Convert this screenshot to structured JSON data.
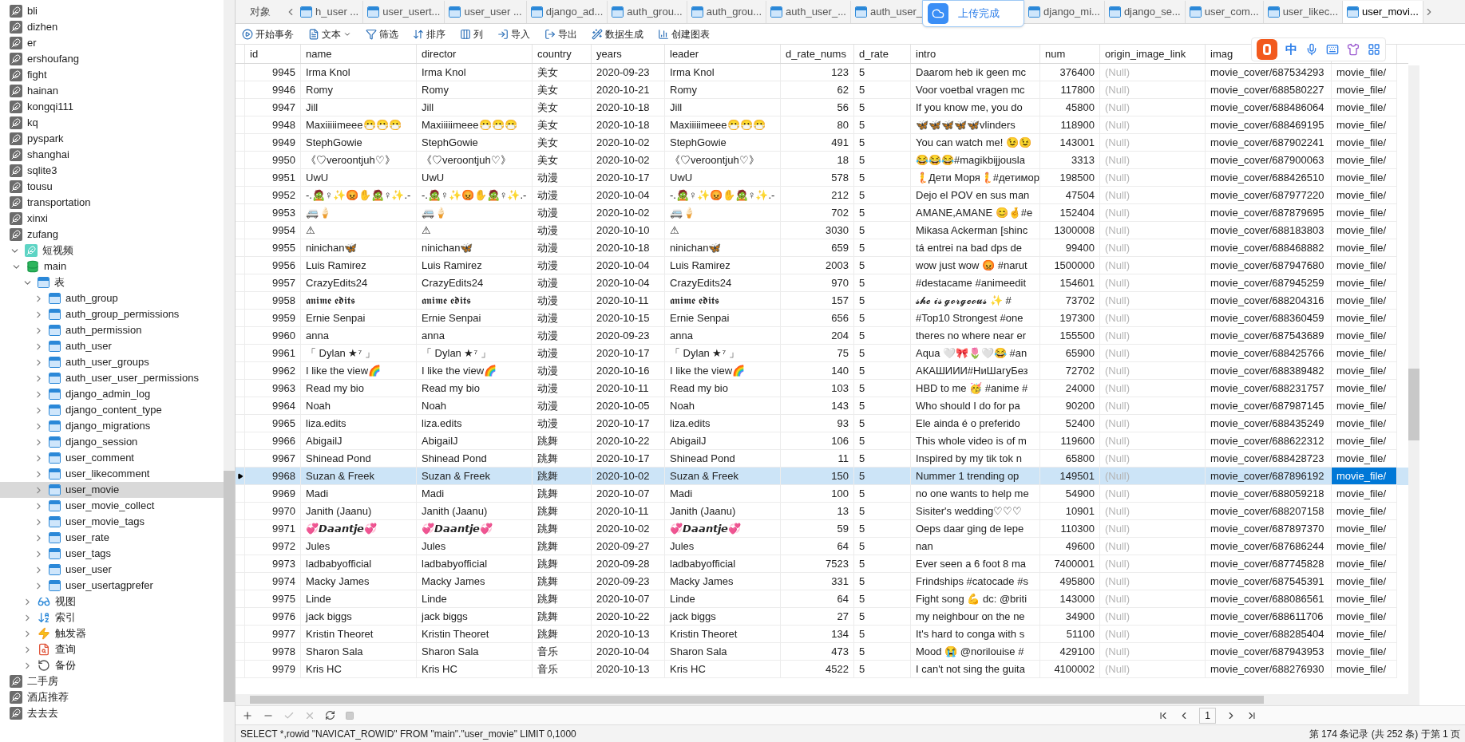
{
  "sidebar": {
    "items": [
      {
        "label": "bli",
        "kind": "connection",
        "expanded": false,
        "selected": false
      },
      {
        "label": "dizhen",
        "kind": "connection",
        "expanded": false,
        "selected": false
      },
      {
        "label": "er",
        "kind": "connection",
        "expanded": false,
        "selected": false
      },
      {
        "label": "ershoufang",
        "kind": "connection",
        "expanded": false,
        "selected": false
      },
      {
        "label": "fight",
        "kind": "connection",
        "expanded": false,
        "selected": false
      },
      {
        "label": "hainan",
        "kind": "connection",
        "expanded": false,
        "selected": false
      },
      {
        "label": "kongqi111",
        "kind": "connection",
        "expanded": false,
        "selected": false
      },
      {
        "label": "kq",
        "kind": "connection",
        "expanded": false,
        "selected": false
      },
      {
        "label": "pyspark",
        "kind": "connection",
        "expanded": false,
        "selected": false
      },
      {
        "label": "shanghai",
        "kind": "connection",
        "expanded": false,
        "selected": false
      },
      {
        "label": "sqlite3",
        "kind": "connection",
        "expanded": false,
        "selected": false
      },
      {
        "label": "tousu",
        "kind": "connection",
        "expanded": false,
        "selected": false
      },
      {
        "label": "transportation",
        "kind": "connection",
        "expanded": false,
        "selected": false
      },
      {
        "label": "xinxi",
        "kind": "connection",
        "expanded": false,
        "selected": false
      },
      {
        "label": "zufang",
        "kind": "connection",
        "expanded": false,
        "selected": false
      },
      {
        "label": "短视频",
        "kind": "active-connection",
        "expanded": true,
        "selected": false,
        "children": [
          {
            "label": "main",
            "kind": "database",
            "expanded": true,
            "selected": false,
            "children": [
              {
                "label": "表",
                "kind": "tables",
                "expanded": true,
                "selected": false,
                "children": [
                  {
                    "label": "auth_group",
                    "kind": "table",
                    "expanded": false,
                    "selected": false
                  },
                  {
                    "label": "auth_group_permissions",
                    "kind": "table",
                    "expanded": false,
                    "selected": false
                  },
                  {
                    "label": "auth_permission",
                    "kind": "table",
                    "expanded": false,
                    "selected": false
                  },
                  {
                    "label": "auth_user",
                    "kind": "table",
                    "expanded": false,
                    "selected": false
                  },
                  {
                    "label": "auth_user_groups",
                    "kind": "table",
                    "expanded": false,
                    "selected": false
                  },
                  {
                    "label": "auth_user_user_permissions",
                    "kind": "table",
                    "expanded": false,
                    "selected": false
                  },
                  {
                    "label": "django_admin_log",
                    "kind": "table",
                    "expanded": false,
                    "selected": false
                  },
                  {
                    "label": "django_content_type",
                    "kind": "table",
                    "expanded": false,
                    "selected": false
                  },
                  {
                    "label": "django_migrations",
                    "kind": "table",
                    "expanded": false,
                    "selected": false
                  },
                  {
                    "label": "django_session",
                    "kind": "table",
                    "expanded": false,
                    "selected": false
                  },
                  {
                    "label": "user_comment",
                    "kind": "table",
                    "expanded": false,
                    "selected": false
                  },
                  {
                    "label": "user_likecomment",
                    "kind": "table",
                    "expanded": false,
                    "selected": false
                  },
                  {
                    "label": "user_movie",
                    "kind": "table",
                    "expanded": false,
                    "selected": true
                  },
                  {
                    "label": "user_movie_collect",
                    "kind": "table",
                    "expanded": false,
                    "selected": false
                  },
                  {
                    "label": "user_movie_tags",
                    "kind": "table",
                    "expanded": false,
                    "selected": false
                  },
                  {
                    "label": "user_rate",
                    "kind": "table",
                    "expanded": false,
                    "selected": false
                  },
                  {
                    "label": "user_tags",
                    "kind": "table",
                    "expanded": false,
                    "selected": false
                  },
                  {
                    "label": "user_user",
                    "kind": "table",
                    "expanded": false,
                    "selected": false
                  },
                  {
                    "label": "user_usertagprefer",
                    "kind": "table",
                    "expanded": false,
                    "selected": false
                  }
                ]
              },
              {
                "label": "视图",
                "kind": "views",
                "expanded": false,
                "selected": false
              },
              {
                "label": "索引",
                "kind": "indexes",
                "expanded": false,
                "selected": false
              },
              {
                "label": "触发器",
                "kind": "triggers",
                "expanded": false,
                "selected": false
              },
              {
                "label": "查询",
                "kind": "queries",
                "expanded": false,
                "selected": false
              },
              {
                "label": "备份",
                "kind": "backups",
                "expanded": false,
                "selected": false
              }
            ]
          }
        ]
      },
      {
        "label": "二手房",
        "kind": "connection",
        "expanded": false,
        "selected": false
      },
      {
        "label": "酒店推荐",
        "kind": "connection",
        "expanded": false,
        "selected": false
      },
      {
        "label": "去去去",
        "kind": "connection",
        "expanded": false,
        "selected": false
      }
    ]
  },
  "tabs": [
    {
      "label": "对象",
      "kind": "objects",
      "selected": false
    },
    {
      "label": "h_user ...",
      "kind": "table",
      "selected": false
    },
    {
      "label": "user_usert...",
      "kind": "table",
      "selected": false
    },
    {
      "label": "user_user ...",
      "kind": "table",
      "selected": false
    },
    {
      "label": "django_ad...",
      "kind": "table",
      "selected": false
    },
    {
      "label": "auth_grou...",
      "kind": "table",
      "selected": false
    },
    {
      "label": "auth_grou...",
      "kind": "table",
      "selected": false
    },
    {
      "label": "auth_user_...",
      "kind": "table",
      "selected": false
    },
    {
      "label": "auth_user_",
      "kind": "table",
      "selected": false
    },
    {
      "label": "django_mi...",
      "kind": "table",
      "selected": false
    },
    {
      "label": "django_se...",
      "kind": "table",
      "selected": false
    },
    {
      "label": "user_com...",
      "kind": "table",
      "selected": false
    },
    {
      "label": "user_likec...",
      "kind": "table",
      "selected": false
    },
    {
      "label": "user_movi...",
      "kind": "table",
      "selected": true
    }
  ],
  "upload_toast": {
    "text": "上传完成"
  },
  "toolbar": [
    {
      "label": "开始事务",
      "kind": "transaction"
    },
    {
      "label": "文本",
      "kind": "text"
    },
    {
      "label": "筛选",
      "kind": "filter"
    },
    {
      "label": "排序",
      "kind": "sort"
    },
    {
      "label": "列",
      "kind": "columns"
    },
    {
      "label": "导入",
      "kind": "import"
    },
    {
      "label": "导出",
      "kind": "export"
    },
    {
      "label": "数据生成",
      "kind": "generate"
    },
    {
      "label": "创建图表",
      "kind": "chart"
    }
  ],
  "ime_bar": {
    "mode": "中"
  },
  "table": {
    "columns": [
      {
        "label": "id",
        "kind": "number",
        "focused": false
      },
      {
        "label": "name",
        "kind": "text",
        "focused": false
      },
      {
        "label": "director",
        "kind": "text",
        "focused": false
      },
      {
        "label": "country",
        "kind": "text",
        "focused": false
      },
      {
        "label": "years",
        "kind": "text",
        "focused": false
      },
      {
        "label": "leader",
        "kind": "text",
        "focused": false
      },
      {
        "label": "d_rate_nums",
        "kind": "number",
        "focused": false
      },
      {
        "label": "d_rate",
        "kind": "text",
        "focused": false
      },
      {
        "label": "intro",
        "kind": "text",
        "focused": false
      },
      {
        "label": "num",
        "kind": "number",
        "focused": false
      },
      {
        "label": "origin_image_link",
        "kind": "null",
        "focused": false
      },
      {
        "label": "imag",
        "kind": "text",
        "focused": false
      },
      {
        "kind": "text",
        "focused": true
      }
    ],
    "rows": [
      {
        "selected": false,
        "cells": [
          "9945",
          "Irma Knol",
          "Irma Knol",
          "美女",
          "2020-09-23",
          "Irma Knol",
          "123",
          "5",
          "Daarom heb ik geen mc",
          "376400",
          "(Null)",
          "movie_cover/687534293",
          "movie_file/"
        ]
      },
      {
        "selected": false,
        "cells": [
          "9946",
          "Romy",
          "Romy",
          "美女",
          "2020-10-21",
          "Romy",
          "62",
          "5",
          "Voor voetbal vragen mc",
          "117800",
          "(Null)",
          "movie_cover/688580227",
          "movie_file/"
        ]
      },
      {
        "selected": false,
        "cells": [
          "9947",
          "Jill",
          "Jill",
          "美女",
          "2020-10-18",
          "Jill",
          "56",
          "5",
          "If you know me, you do",
          "45800",
          "(Null)",
          "movie_cover/688486064",
          "movie_file/"
        ]
      },
      {
        "selected": false,
        "cells": [
          "9948",
          "Maxiiiiimeee😷😷😷",
          "Maxiiiiimeee😷😷😷",
          "美女",
          "2020-10-18",
          "Maxiiiiimeee😷😷😷",
          "80",
          "5",
          "🦋🦋🦋🦋🦋vlinders",
          "118900",
          "(Null)",
          "movie_cover/688469195",
          "movie_file/"
        ]
      },
      {
        "selected": false,
        "cells": [
          "9949",
          "StephGowie",
          "StephGowie",
          "美女",
          "2020-10-02",
          "StephGowie",
          "491",
          "5",
          "You can watch me! 😉😉",
          "143001",
          "(Null)",
          "movie_cover/687902241",
          "movie_file/"
        ]
      },
      {
        "selected": false,
        "cells": [
          "9950",
          "《♡veroontjuh♡》",
          "《♡veroontjuh♡》",
          "美女",
          "2020-10-02",
          "《♡veroontjuh♡》",
          "18",
          "5",
          "😂😂😂#magikbijjousla",
          "3313",
          "(Null)",
          "movie_cover/687900063",
          "movie_file/"
        ]
      },
      {
        "selected": false,
        "cells": [
          "9951",
          "UwU",
          "UwU",
          "动漫",
          "2020-10-17",
          "UwU",
          "578",
          "5",
          "🧜Дети Моря🧜#детимор",
          "198500",
          "(Null)",
          "movie_cover/688426510",
          "movie_file/"
        ]
      },
      {
        "selected": false,
        "cells": [
          "9952",
          "-.🧟♀✨😡✋🧟♀✨.-",
          "-.🧟♀✨😡✋🧟♀✨.-",
          "动漫",
          "2020-10-04",
          "-.🧟♀✨😡✋🧟♀✨.-",
          "212",
          "5",
          "Dejo el POV en sus man",
          "47504",
          "(Null)",
          "movie_cover/687977220",
          "movie_file/"
        ]
      },
      {
        "selected": false,
        "cells": [
          "9953",
          "🚐🍦",
          "🚐🍦",
          "动漫",
          "2020-10-02",
          "🚐🍦",
          "702",
          "5",
          "AMANE,AMANE 😊🤞#e",
          "152404",
          "(Null)",
          "movie_cover/687879695",
          "movie_file/"
        ]
      },
      {
        "selected": false,
        "cells": [
          "9954",
          "⚠",
          "⚠",
          "动漫",
          "2020-10-10",
          "⚠",
          "3030",
          "5",
          "Mikasa Ackerman [shinc",
          "1300008",
          "(Null)",
          "movie_cover/688183803",
          "movie_file/"
        ]
      },
      {
        "selected": false,
        "cells": [
          "9955",
          "ninichan🦋",
          "ninichan🦋",
          "动漫",
          "2020-10-18",
          "ninichan🦋",
          "659",
          "5",
          "tá entrei na bad dps de",
          "99400",
          "(Null)",
          "movie_cover/688468882",
          "movie_file/"
        ]
      },
      {
        "selected": false,
        "cells": [
          "9956",
          "Luis Ramirez",
          "Luis Ramirez",
          "动漫",
          "2020-10-04",
          "Luis Ramirez",
          "2003",
          "5",
          "wow just wow 😡 #narut",
          "1500000",
          "(Null)",
          "movie_cover/687947680",
          "movie_file/"
        ]
      },
      {
        "selected": false,
        "cells": [
          "9957",
          "CrazyEdits24",
          "CrazyEdits24",
          "动漫",
          "2020-10-04",
          "CrazyEdits24",
          "970",
          "5",
          "#destacame #animeedit",
          "154601",
          "(Null)",
          "movie_cover/687945259",
          "movie_file/"
        ]
      },
      {
        "selected": false,
        "cells": [
          "9958",
          "𝖆𝖓𝖎𝖒𝖊 𝖊𝖉𝖎𝖙𝖘",
          "𝖆𝖓𝖎𝖒𝖊 𝖊𝖉𝖎𝖙𝖘",
          "动漫",
          "2020-10-11",
          "𝖆𝖓𝖎𝖒𝖊 𝖊𝖉𝖎𝖙𝖘",
          "157",
          "5",
          "𝓼𝓱𝓮 𝓲𝓼 𝓰𝓸𝓻𝓰𝓮𝓸𝓾𝓼 ✨ #",
          "73702",
          "(Null)",
          "movie_cover/688204316",
          "movie_file/"
        ]
      },
      {
        "selected": false,
        "cells": [
          "9959",
          "Ernie Senpai",
          "Ernie Senpai",
          "动漫",
          "2020-10-15",
          "Ernie Senpai",
          "656",
          "5",
          "#Top10 Strongest #one",
          "197300",
          "(Null)",
          "movie_cover/688360459",
          "movie_file/"
        ]
      },
      {
        "selected": false,
        "cells": [
          "9960",
          "anna",
          "anna",
          "动漫",
          "2020-09-23",
          "anna",
          "204",
          "5",
          "theres no where near er",
          "155500",
          "(Null)",
          "movie_cover/687543689",
          "movie_file/"
        ]
      },
      {
        "selected": false,
        "cells": [
          "9961",
          "「 Dylan ★⁷ 」",
          "「 Dylan ★⁷ 」",
          "动漫",
          "2020-10-17",
          "「 Dylan ★⁷ 」",
          "75",
          "5",
          "Aqua 🤍🎀🌷🤍😂 #an",
          "65900",
          "(Null)",
          "movie_cover/688425766",
          "movie_file/"
        ]
      },
      {
        "selected": false,
        "cells": [
          "9962",
          "I like the view🌈",
          "I like the view🌈",
          "动漫",
          "2020-10-16",
          "I like the view🌈",
          "140",
          "5",
          "АКАШИИИ#НиШагуБез",
          "72702",
          "(Null)",
          "movie_cover/688389482",
          "movie_file/"
        ]
      },
      {
        "selected": false,
        "cells": [
          "9963",
          "Read my bio",
          "Read my bio",
          "动漫",
          "2020-10-11",
          "Read my bio",
          "103",
          "5",
          "HBD to me 🥳 #anime #",
          "24000",
          "(Null)",
          "movie_cover/688231757",
          "movie_file/"
        ]
      },
      {
        "selected": false,
        "cells": [
          "9964",
          "Noah",
          "Noah",
          "动漫",
          "2020-10-05",
          "Noah",
          "143",
          "5",
          "Who should I do for pa",
          "90200",
          "(Null)",
          "movie_cover/687987145",
          "movie_file/"
        ]
      },
      {
        "selected": false,
        "cells": [
          "9965",
          "liza.edits",
          "liza.edits",
          "动漫",
          "2020-10-17",
          "liza.edits",
          "93",
          "5",
          "Ele ainda é o preferido",
          "52400",
          "(Null)",
          "movie_cover/688435249",
          "movie_file/"
        ]
      },
      {
        "selected": false,
        "cells": [
          "9966",
          "AbigailJ",
          "AbigailJ",
          "跳舞",
          "2020-10-22",
          "AbigailJ",
          "106",
          "5",
          "This whole video is of m",
          "119600",
          "(Null)",
          "movie_cover/688622312",
          "movie_file/"
        ]
      },
      {
        "selected": false,
        "cells": [
          "9967",
          "Shinead Pond",
          "Shinead Pond",
          "跳舞",
          "2020-10-17",
          "Shinead Pond",
          "11",
          "5",
          "Inspired by my tik tok n",
          "65800",
          "(Null)",
          "movie_cover/688428723",
          "movie_file/"
        ]
      },
      {
        "selected": true,
        "cells": [
          "9968",
          "Suzan & Freek",
          "Suzan & Freek",
          "跳舞",
          "2020-10-02",
          "Suzan & Freek",
          "150",
          "5",
          "Nummer 1 trending op",
          "149501",
          "(Null)",
          "movie_cover/687896192",
          "movie_file/"
        ]
      },
      {
        "selected": false,
        "cells": [
          "9969",
          "Madi",
          "Madi",
          "跳舞",
          "2020-10-07",
          "Madi",
          "100",
          "5",
          "no one wants to help me",
          "54900",
          "(Null)",
          "movie_cover/688059218",
          "movie_file/"
        ]
      },
      {
        "selected": false,
        "cells": [
          "9970",
          "Janith (Jaanu)",
          "Janith (Jaanu)",
          "跳舞",
          "2020-10-11",
          "Janith (Jaanu)",
          "13",
          "5",
          "Sisiter's wedding♡♡♡",
          "10901",
          "(Null)",
          "movie_cover/688207158",
          "movie_file/"
        ]
      },
      {
        "selected": false,
        "cells": [
          "9971",
          "💞𝘿𝙖𝙖𝙣𝙩𝙟𝙚💞",
          "💞𝘿𝙖𝙖𝙣𝙩𝙟𝙚💞",
          "跳舞",
          "2020-10-02",
          "💞𝘿𝙖𝙖𝙣𝙩𝙟𝙚💞",
          "59",
          "5",
          "Oeps daar ging de lepe",
          "110300",
          "(Null)",
          "movie_cover/687897370",
          "movie_file/"
        ]
      },
      {
        "selected": false,
        "cells": [
          "9972",
          "Jules",
          "Jules",
          "跳舞",
          "2020-09-27",
          "Jules",
          "64",
          "5",
          "nan",
          "49600",
          "(Null)",
          "movie_cover/687686244",
          "movie_file/"
        ]
      },
      {
        "selected": false,
        "cells": [
          "9973",
          "ladbabyofficial",
          "ladbabyofficial",
          "跳舞",
          "2020-09-28",
          "ladbabyofficial",
          "7523",
          "5",
          "Ever seen a 6 foot 8 ma",
          "7400001",
          "(Null)",
          "movie_cover/687745828",
          "movie_file/"
        ]
      },
      {
        "selected": false,
        "cells": [
          "9974",
          "Macky James",
          "Macky James",
          "跳舞",
          "2020-09-23",
          "Macky James",
          "331",
          "5",
          "Frindships #catocade #s",
          "495800",
          "(Null)",
          "movie_cover/687545391",
          "movie_file/"
        ]
      },
      {
        "selected": false,
        "cells": [
          "9975",
          "Linde",
          "Linde",
          "跳舞",
          "2020-10-07",
          "Linde",
          "64",
          "5",
          "Fight song 💪 dc: @briti",
          "143000",
          "(Null)",
          "movie_cover/688086561",
          "movie_file/"
        ]
      },
      {
        "selected": false,
        "cells": [
          "9976",
          "jack biggs",
          "jack biggs",
          "跳舞",
          "2020-10-22",
          "jack biggs",
          "27",
          "5",
          "my neighbour on the ne",
          "34900",
          "(Null)",
          "movie_cover/688611706",
          "movie_file/"
        ]
      },
      {
        "selected": false,
        "cells": [
          "9977",
          "Kristin Theoret",
          "Kristin Theoret",
          "跳舞",
          "2020-10-13",
          "Kristin Theoret",
          "134",
          "5",
          "It's hard to conga with s",
          "51100",
          "(Null)",
          "movie_cover/688285404",
          "movie_file/"
        ]
      },
      {
        "selected": false,
        "cells": [
          "9978",
          "Sharon Sala",
          "Sharon Sala",
          "音乐",
          "2020-10-04",
          "Sharon Sala",
          "473",
          "5",
          "Mood 😭 @norilouise #",
          "429100",
          "(Null)",
          "movie_cover/687943953",
          "movie_file/"
        ]
      },
      {
        "selected": false,
        "cells": [
          "9979",
          "Kris HC",
          "Kris HC",
          "音乐",
          "2020-10-13",
          "Kris HC",
          "4522",
          "5",
          "I can't not sing the guita",
          "4100002",
          "(Null)",
          "movie_cover/688276930",
          "movie_file/"
        ]
      }
    ]
  },
  "pager": {
    "page": "1"
  },
  "status_bar": {
    "sql": "SELECT *,rowid \"NAVICAT_ROWID\" FROM \"main\".\"user_movie\" LIMIT 0,1000",
    "record_info": "第 174 条记录 (共 252 条) 于第 1 页"
  }
}
